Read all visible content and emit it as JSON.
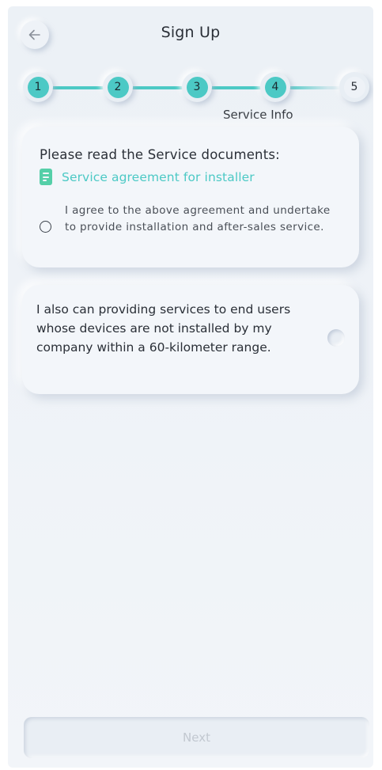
{
  "header": {
    "title": "Sign Up",
    "back_icon": "arrow-left-icon"
  },
  "stepper": {
    "steps": [
      {
        "label": "1",
        "state": "done"
      },
      {
        "label": "2",
        "state": "done"
      },
      {
        "label": "3",
        "state": "done"
      },
      {
        "label": "4",
        "state": "current"
      },
      {
        "label": "5",
        "state": "pending"
      }
    ],
    "current_caption": "Service Info"
  },
  "service_card": {
    "heading": "Please read the Service documents:",
    "document_link": "Service agreement for installer",
    "document_icon": "document-icon",
    "agreement_text": "I agree to the above agreement and undertake to provide installation and after-sales service.",
    "agreement_checked": false
  },
  "extra_service_card": {
    "text": "I also can providing services to end users whose devices are not installed by my company within a 60-kilometer range.",
    "checked": false
  },
  "footer": {
    "next_label": "Next",
    "next_enabled": false
  },
  "colors": {
    "accent": "#4cc9c5",
    "doc_icon": "#55cfa8",
    "background": "#eef2f7",
    "disabled_text": "#c2c8d0"
  }
}
